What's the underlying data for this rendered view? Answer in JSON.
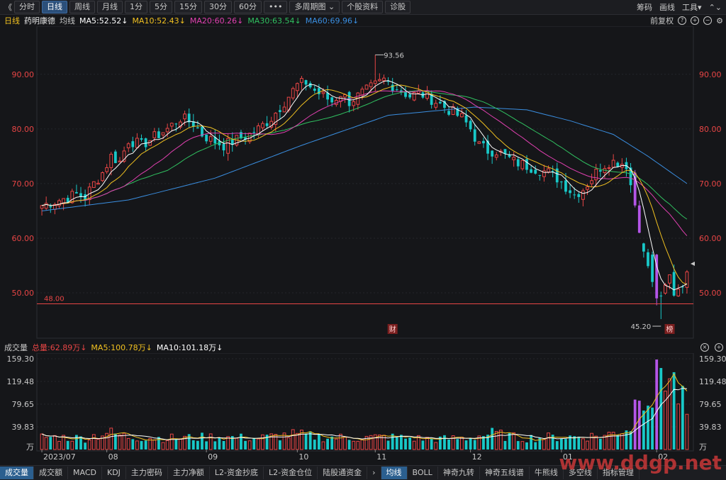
{
  "toolbar": {
    "back": "《",
    "buttons": [
      "分时",
      "日线",
      "周线",
      "月线",
      "1分",
      "5分",
      "15分",
      "30分",
      "60分",
      "•••",
      "多周期图 ⌄",
      "个股资料",
      "诊股"
    ],
    "active_index": 1,
    "right": [
      "筹码",
      "画线",
      "工具▾",
      "⌃⌄"
    ]
  },
  "header": {
    "period": "日线",
    "stock": "药明康德",
    "avg_label": "均线",
    "ma5": "MA5:52.52↓",
    "ma10": "MA10:52.43↓",
    "ma20": "MA20:60.26↓",
    "ma30": "MA30:63.54↓",
    "ma60": "MA60:69.96↓",
    "adjust": "前复权",
    "colors": {
      "ma5": "#ffffff",
      "ma10": "#f0c020",
      "ma20": "#e040b0",
      "ma30": "#30c060",
      "ma60": "#3a8ee0",
      "up": "#e84545",
      "down": "#18c8c8"
    }
  },
  "price_axis": {
    "ticks": [
      "90.00",
      "80.00",
      "70.00",
      "60.00",
      "50.00"
    ],
    "tick_values": [
      90,
      80,
      70,
      60,
      50
    ],
    "min": 43,
    "max": 97.5
  },
  "annotations": {
    "high": "93.56",
    "high_value": 93.56,
    "low": "45.20",
    "low_value": 45.2,
    "hline": "48.00",
    "hline_value": 48.0,
    "marker1": "财",
    "marker2": "榜"
  },
  "volume": {
    "title": "成交量",
    "total": "总量:62.89万↓",
    "ma5": "MA5:100.78万↓",
    "ma10": "MA10:101.18万↓",
    "ticks": [
      "159.30",
      "119.48",
      "79.65",
      "39.83"
    ],
    "tick_values": [
      159.3,
      119.48,
      79.65,
      39.83
    ],
    "unit": "万",
    "max": 159.3
  },
  "x_axis": {
    "labels": [
      {
        "text": "2023/07",
        "i": 0
      },
      {
        "text": "08",
        "i": 15
      },
      {
        "text": "09",
        "i": 38
      },
      {
        "text": "10",
        "i": 59
      },
      {
        "text": "11",
        "i": 77
      },
      {
        "text": "12",
        "i": 99
      },
      {
        "text": "01",
        "i": 120
      },
      {
        "text": "02",
        "i": 142
      }
    ]
  },
  "bottom_tabs": [
    "成交量",
    "成交额",
    "MACD",
    "KDJ",
    "主力密码",
    "主力净额",
    "L2-资金抄底",
    "L2-资金仓位",
    "陆股通资金",
    "›",
    "均线",
    "BOLL",
    "神奇九转",
    "神奇五线谱",
    "牛熊线",
    "多空线",
    "指标管理"
  ],
  "watermark": "www.ddgp.net",
  "chart_data": {
    "type": "candlestick",
    "title": "",
    "count": 150,
    "anchors_close": [
      [
        0,
        66
      ],
      [
        4,
        67
      ],
      [
        8,
        68
      ],
      [
        10,
        67.5
      ],
      [
        12,
        70
      ],
      [
        14,
        72
      ],
      [
        16,
        75
      ],
      [
        18,
        74
      ],
      [
        20,
        78
      ],
      [
        23,
        77
      ],
      [
        25,
        78
      ],
      [
        27,
        79
      ],
      [
        29,
        80
      ],
      [
        32,
        82
      ],
      [
        35,
        81
      ],
      [
        37,
        79
      ],
      [
        39,
        78
      ],
      [
        42,
        77
      ],
      [
        45,
        78
      ],
      [
        48,
        79
      ],
      [
        50,
        80
      ],
      [
        53,
        82
      ],
      [
        55,
        84
      ],
      [
        57,
        86
      ],
      [
        59,
        88
      ],
      [
        61,
        88.5
      ],
      [
        63,
        87
      ],
      [
        65,
        86
      ],
      [
        67,
        85
      ],
      [
        69,
        86.5
      ],
      [
        71,
        85
      ],
      [
        73,
        86
      ],
      [
        75,
        87
      ],
      [
        77,
        88
      ],
      [
        79,
        89
      ],
      [
        81,
        88
      ],
      [
        83,
        87
      ],
      [
        85,
        86
      ],
      [
        87,
        86.5
      ],
      [
        89,
        86
      ],
      [
        91,
        85
      ],
      [
        93,
        84
      ],
      [
        95,
        83
      ],
      [
        97,
        82
      ],
      [
        99,
        80
      ],
      [
        101,
        77
      ],
      [
        103,
        76
      ],
      [
        105,
        76
      ],
      [
        107,
        75
      ],
      [
        109,
        74
      ],
      [
        111,
        73.5
      ],
      [
        113,
        73
      ],
      [
        115,
        72.5
      ],
      [
        117,
        72
      ],
      [
        119,
        71
      ],
      [
        121,
        69.5
      ],
      [
        123,
        68
      ],
      [
        125,
        69
      ],
      [
        127,
        71
      ],
      [
        129,
        73
      ],
      [
        131,
        74
      ],
      [
        133,
        74
      ],
      [
        135,
        73.5
      ],
      [
        137,
        66
      ],
      [
        138,
        60
      ],
      [
        139,
        57
      ],
      [
        140,
        55
      ],
      [
        141,
        53
      ],
      [
        142,
        50
      ],
      [
        143,
        48.5
      ],
      [
        144,
        51
      ],
      [
        145,
        53
      ],
      [
        146,
        50
      ],
      [
        147,
        51
      ],
      [
        148,
        52
      ],
      [
        149,
        53
      ]
    ],
    "ma60_anchors": [
      [
        0,
        65
      ],
      [
        20,
        67
      ],
      [
        40,
        71
      ],
      [
        60,
        77
      ],
      [
        80,
        82.5
      ],
      [
        100,
        84
      ],
      [
        112,
        83.5
      ],
      [
        122,
        81.5
      ],
      [
        132,
        79
      ],
      [
        140,
        75
      ],
      [
        149,
        70
      ]
    ],
    "volume_anchors": [
      [
        0,
        22
      ],
      [
        10,
        20
      ],
      [
        15,
        30
      ],
      [
        20,
        22
      ],
      [
        30,
        20
      ],
      [
        40,
        22
      ],
      [
        50,
        20
      ],
      [
        58,
        26
      ],
      [
        65,
        22
      ],
      [
        72,
        20
      ],
      [
        80,
        22
      ],
      [
        90,
        18
      ],
      [
        98,
        20
      ],
      [
        104,
        28
      ],
      [
        110,
        20
      ],
      [
        120,
        22
      ],
      [
        130,
        24
      ],
      [
        136,
        40
      ],
      [
        138,
        120
      ],
      [
        141,
        90
      ],
      [
        143,
        150
      ],
      [
        146,
        115
      ],
      [
        149,
        63
      ]
    ]
  }
}
